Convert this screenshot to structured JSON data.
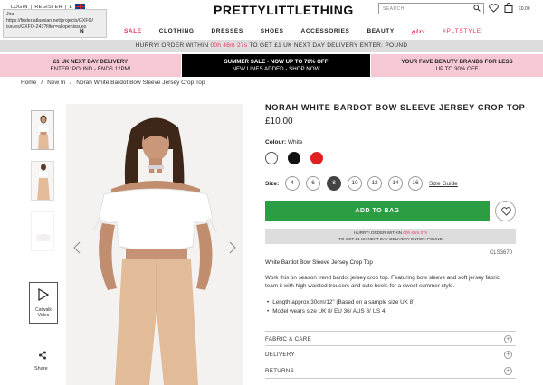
{
  "header": {
    "login": "LOGIN",
    "register": "REGISTER",
    "currency": "£",
    "tooltip": [
      "Jira",
      "https://finder.atlassian.net/projects/GXFO/",
      "issues/GXFO-243?filter=allopenissues"
    ],
    "logo": "PRETTYLITTLETHING",
    "search_placeholder": "SEARCH",
    "basket_total": "£0.00"
  },
  "nav": {
    "items": [
      "SALE",
      "CLOTHING",
      "DRESSES",
      "SHOES",
      "ACCESSORIES",
      "BEAUTY"
    ],
    "girl": "girl",
    "pts": "#PLTSTYLE",
    "partial": "N"
  },
  "hurry_banner": {
    "prefix": "HURRY! ORDER WITHIN",
    "timer": "00h 46m 27s",
    "suffix": "TO GET £1 UK NEXT DAY DELIVERY ENTER: POUND"
  },
  "promos": [
    {
      "line1": "£1 UK NEXT DAY DELIVERY",
      "line2": "ENTER: POUND - ENDS 12PM!"
    },
    {
      "line1": "SUMMER SALE - NOW UP TO 70% OFF",
      "line2": "NEW LINES ADDED - SHOP NOW"
    },
    {
      "line1": "YOUR FAVE BEAUTY BRANDS FOR LESS",
      "line2": "UP TO 30% OFF"
    }
  ],
  "breadcrumb": [
    "Home",
    "/",
    "New In",
    "/",
    "Norah White Bardot Bow Sleeve Jersey Crop Top"
  ],
  "gallery": {
    "video_label": "Catwalk Video",
    "share_label": "Share"
  },
  "product": {
    "title": "NORAH WHITE BARDOT BOW SLEEVE JERSEY CROP TOP",
    "price": "£10.00",
    "colour_label": "Colour:",
    "colour_value": "White",
    "swatches": [
      "#ffffff",
      "#111111",
      "#e02020"
    ],
    "size_label": "Size:",
    "sizes": [
      "4",
      "6",
      "8",
      "10",
      "12",
      "14",
      "16"
    ],
    "selected_size": "8",
    "size_guide": "Size Guide",
    "add_to_bag": "ADD TO BAG",
    "hurry_line1_prefix": "HURRY! ORDER WITHIN",
    "hurry_timer": "00h 46m 27s",
    "hurry_line2": "TO GET £1 UK NEXT DAY DELIVERY ENTER: POUND",
    "code": "CLS3670",
    "subname": "White Bardot Bow Sleeve Jersey Crop Top",
    "description": "Work this on season trend bardot jersey crop top. Featuring bow sleeve and soft jersey fabric, team it with high waisted trousers and cute heels for a sweet summer style.",
    "bullets": [
      "Length approx 30cm/12\" (Based on a sample size UK 8)",
      "Model wears size UK 8/ EU 36/ AUS 8/ US 4"
    ],
    "accordions": [
      "FABRIC & CARE",
      "DELIVERY",
      "RETURNS"
    ]
  }
}
